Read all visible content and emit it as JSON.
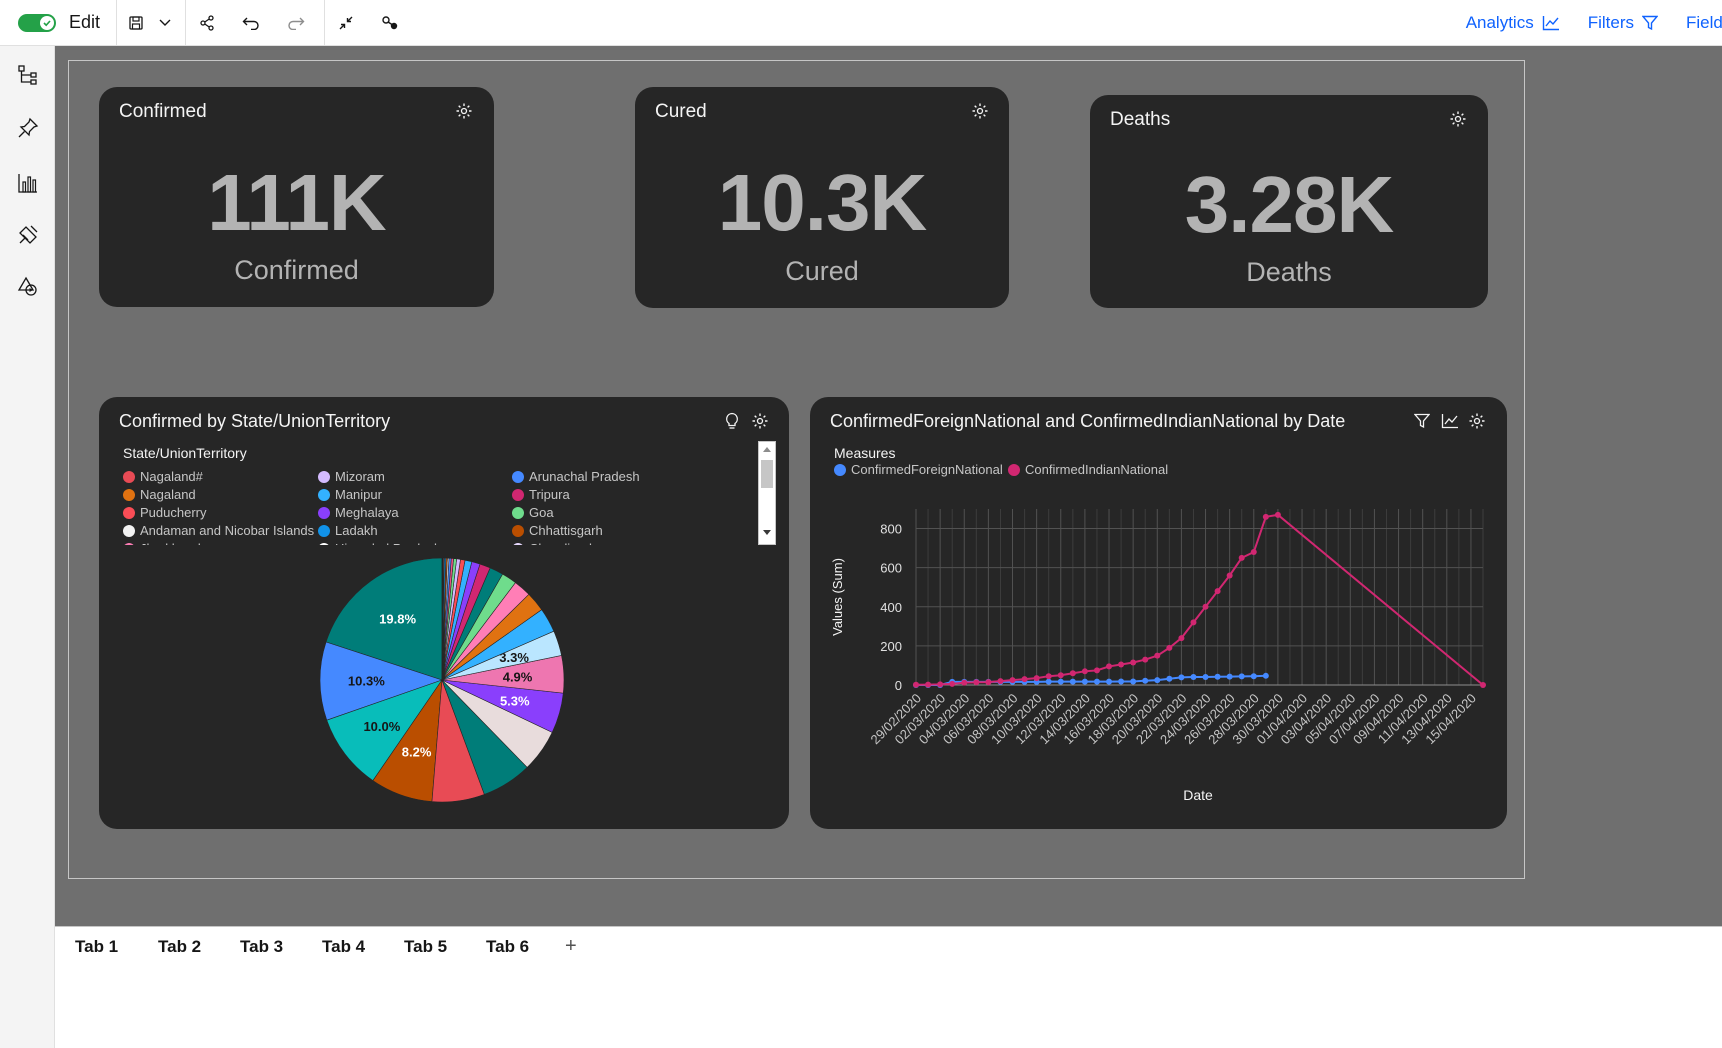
{
  "toolbar": {
    "edit_label": "Edit",
    "analytics_label": "Analytics",
    "filters_label": "Filters",
    "fields_label": "Fields",
    "toggle_color": "#24a148",
    "link_color": "#0f62fe"
  },
  "sidebar": {
    "items": [
      {
        "icon": "tree-icon"
      },
      {
        "icon": "pin-icon"
      },
      {
        "icon": "bar-chart-icon"
      },
      {
        "icon": "paint-icon"
      },
      {
        "icon": "shapes-icon"
      }
    ]
  },
  "kpis": [
    {
      "title": "Confirmed",
      "value": "111K",
      "label": "Confirmed"
    },
    {
      "title": "Cured",
      "value": "10.3K",
      "label": "Cured"
    },
    {
      "title": "Deaths",
      "value": "3.28K",
      "label": "Deaths"
    }
  ],
  "pie_card": {
    "title": "Confirmed by State/UnionTerritory",
    "legend_title": "State/UnionTerritory",
    "legend": [
      {
        "name": "Nagaland#",
        "color": "#e84b55"
      },
      {
        "name": "Mizoram",
        "color": "#d4bbff"
      },
      {
        "name": "Arunachal Pradesh",
        "color": "#4589ff"
      },
      {
        "name": "Nagaland",
        "color": "#e07211"
      },
      {
        "name": "Manipur",
        "color": "#33b1ff"
      },
      {
        "name": "Tripura",
        "color": "#d12771"
      },
      {
        "name": "Puducherry",
        "color": "#fa4d56"
      },
      {
        "name": "Meghalaya",
        "color": "#8a3ffc"
      },
      {
        "name": "Goa",
        "color": "#6fdc8c"
      },
      {
        "name": "Andaman and Nicobar Islands",
        "color": "#f2f2f2"
      },
      {
        "name": "Ladakh",
        "color": "#1192e8"
      },
      {
        "name": "Chhattisgarh",
        "color": "#ba4e00"
      },
      {
        "name": "Jharkhand",
        "color": "#ff7eb6"
      },
      {
        "name": "Himachal Pradesh",
        "color": "#ffffff"
      },
      {
        "name": "Chandigarh",
        "color": "#e8daff"
      }
    ]
  },
  "line_card": {
    "title": "ConfirmedForeignNational and ConfirmedIndianNational by Date",
    "legend_title": "Measures",
    "series_labels": [
      "ConfirmedForeignNational",
      "ConfirmedIndianNational"
    ],
    "series_colors": [
      "#4589ff",
      "#d12771"
    ]
  },
  "chart_data": [
    {
      "type": "pie",
      "title": "Confirmed by State/UnionTerritory",
      "slices": [
        {
          "label": "",
          "value": 19.8,
          "color": "#007d79",
          "text": "19.8%"
        },
        {
          "label": "",
          "value": 10.3,
          "color": "#4589ff",
          "text": "10.3%"
        },
        {
          "label": "",
          "value": 10.0,
          "color": "#08bdba",
          "text": "10.0%"
        },
        {
          "label": "",
          "value": 8.2,
          "color": "#ba4e00",
          "text": "8.2%"
        },
        {
          "label": "",
          "value": 6.9,
          "color": "#e84b55",
          "text": ""
        },
        {
          "label": "",
          "value": 6.6,
          "color": "#007d79",
          "text": ""
        },
        {
          "label": "",
          "value": 5.6,
          "color": "#e8dcdc",
          "text": ""
        },
        {
          "label": "",
          "value": 5.3,
          "color": "#8a3ffc",
          "text": "5.3%"
        },
        {
          "label": "",
          "value": 4.9,
          "color": "#ee76b0",
          "text": "4.9%"
        },
        {
          "label": "",
          "value": 3.3,
          "color": "#bae6ff",
          "text": "3.3%"
        },
        {
          "label": "",
          "value": 3.2,
          "color": "#33b1ff",
          "text": ""
        },
        {
          "label": "",
          "value": 2.6,
          "color": "#e07211",
          "text": ""
        },
        {
          "label": "",
          "value": 2.3,
          "color": "#ff7eb6",
          "text": ""
        },
        {
          "label": "",
          "value": 2.0,
          "color": "#6fdc8c",
          "text": ""
        },
        {
          "label": "",
          "value": 1.8,
          "color": "#007d79",
          "text": ""
        },
        {
          "label": "",
          "value": 1.4,
          "color": "#d12771",
          "text": ""
        },
        {
          "label": "",
          "value": 1.1,
          "color": "#8a3ffc",
          "text": ""
        },
        {
          "label": "",
          "value": 0.9,
          "color": "#33b1ff",
          "text": ""
        },
        {
          "label": "",
          "value": 0.6,
          "color": "#fa4d56",
          "text": ""
        },
        {
          "label": "",
          "value": 0.5,
          "color": "#d4bbff",
          "text": ""
        },
        {
          "label": "",
          "value": 0.4,
          "color": "#6fdc8c",
          "text": ""
        },
        {
          "label": "",
          "value": 0.3,
          "color": "#ee538b",
          "text": ""
        },
        {
          "label": "",
          "value": 0.3,
          "color": "#4589ff",
          "text": ""
        },
        {
          "label": "",
          "value": 0.2,
          "color": "#fff1f1",
          "text": ""
        },
        {
          "label": "",
          "value": 0.2,
          "color": "#ba4e00",
          "text": ""
        },
        {
          "label": "",
          "value": 0.2,
          "color": "#1192e8",
          "text": ""
        },
        {
          "label": "",
          "value": 0.1,
          "color": "#e07211",
          "text": ""
        },
        {
          "label": "",
          "value": 0.1,
          "color": "#ff7eb6",
          "text": ""
        },
        {
          "label": "",
          "value": 0.1,
          "color": "#161616",
          "text": ""
        }
      ]
    },
    {
      "type": "line",
      "title": "ConfirmedForeignNational and ConfirmedIndianNational by Date",
      "xlabel": "Date",
      "ylabel": "Values (Sum)",
      "ylim": [
        0,
        900
      ],
      "yticks": [
        0,
        200,
        400,
        600,
        800
      ],
      "xticks": [
        "29/02/2020",
        "02/03/2020",
        "04/03/2020",
        "06/03/2020",
        "08/03/2020",
        "10/03/2020",
        "12/03/2020",
        "14/03/2020",
        "16/03/2020",
        "18/03/2020",
        "20/03/2020",
        "22/03/2020",
        "24/03/2020",
        "26/03/2020",
        "28/03/2020",
        "30/03/2020",
        "01/04/2020",
        "03/04/2020",
        "05/04/2020",
        "07/04/2020",
        "09/04/2020",
        "11/04/2020",
        "13/04/2020",
        "15/04/2020"
      ],
      "series": [
        {
          "name": "ConfirmedForeignNational",
          "color": "#4589ff",
          "x": [
            "30/01/2020",
            "01/03/2020",
            "02/03/2020",
            "03/03/2020",
            "04/03/2020",
            "05/03/2020",
            "06/03/2020",
            "07/03/2020",
            "08/03/2020",
            "09/03/2020",
            "10/03/2020",
            "11/03/2020",
            "12/03/2020",
            "13/03/2020",
            "14/03/2020",
            "15/03/2020",
            "16/03/2020",
            "17/03/2020",
            "18/03/2020",
            "19/03/2020",
            "20/03/2020",
            "21/03/2020",
            "22/03/2020",
            "23/03/2020",
            "24/03/2020",
            "25/03/2020",
            "26/03/2020",
            "27/03/2020",
            "28/03/2020",
            "29/03/2020"
          ],
          "values": [
            0,
            0,
            0,
            16,
            16,
            16,
            16,
            16,
            16,
            16,
            16,
            17,
            17,
            17,
            17,
            17,
            17,
            18,
            18,
            22,
            25,
            32,
            39,
            41,
            41,
            42,
            43,
            44,
            45,
            47
          ]
        },
        {
          "name": "ConfirmedIndianNational",
          "color": "#d12771",
          "x": [
            "30/01/2020",
            "01/03/2020",
            "02/03/2020",
            "03/03/2020",
            "04/03/2020",
            "05/03/2020",
            "06/03/2020",
            "07/03/2020",
            "08/03/2020",
            "09/03/2020",
            "10/03/2020",
            "11/03/2020",
            "12/03/2020",
            "13/03/2020",
            "14/03/2020",
            "15/03/2020",
            "16/03/2020",
            "17/03/2020",
            "18/03/2020",
            "19/03/2020",
            "20/03/2020",
            "21/03/2020",
            "22/03/2020",
            "23/03/2020",
            "24/03/2020",
            "25/03/2020",
            "26/03/2020",
            "27/03/2020",
            "28/03/2020",
            "29/03/2020",
            "30/03/2020",
            "16/04/2020"
          ],
          "values": [
            1,
            2,
            3,
            6,
            12,
            14,
            15,
            20,
            25,
            30,
            35,
            45,
            50,
            60,
            70,
            75,
            95,
            105,
            115,
            130,
            150,
            190,
            240,
            320,
            400,
            480,
            560,
            650,
            680,
            860,
            870,
            0
          ]
        }
      ]
    }
  ],
  "tabs": [
    {
      "label": "Tab 1"
    },
    {
      "label": "Tab 2"
    },
    {
      "label": "Tab 3"
    },
    {
      "label": "Tab 4"
    },
    {
      "label": "Tab 5"
    },
    {
      "label": "Tab 6"
    }
  ],
  "add_tab_label": "+"
}
